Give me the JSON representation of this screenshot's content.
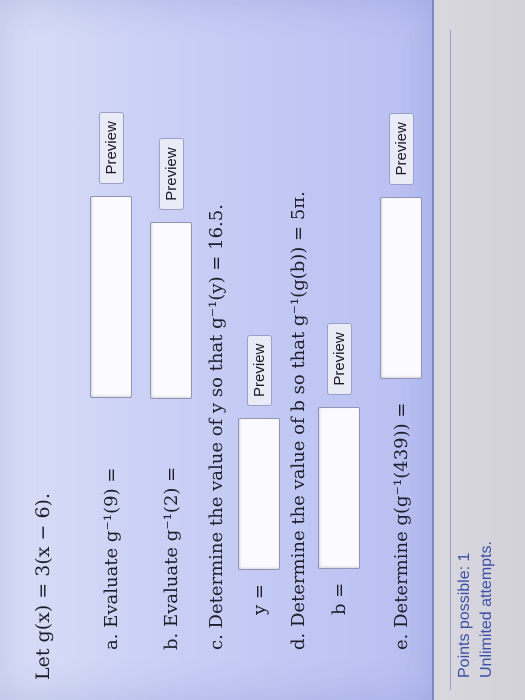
{
  "problem": {
    "intro": "Let g(x) = 3(x − 6).",
    "a": {
      "label": "a. Evaluate g⁻¹(9) =",
      "value": "",
      "preview": "Preview"
    },
    "b": {
      "label": "b. Evaluate g⁻¹(2) =",
      "value": "",
      "preview": "Preview"
    },
    "c": {
      "label": "c. Determine the value of y so that g⁻¹(y) = 16.5.",
      "var": "y =",
      "value": "",
      "preview": "Preview"
    },
    "d": {
      "label": "d. Determine the value of b so that g⁻¹(g(b)) = 5π.",
      "var": "b =",
      "value": "",
      "preview": "Preview"
    },
    "e": {
      "label": "e. Determine g(g⁻¹(439)) =",
      "value": "",
      "preview": "Preview"
    }
  },
  "footer": {
    "points": "Points possible: 1",
    "attempts": "Unlimited attempts."
  }
}
